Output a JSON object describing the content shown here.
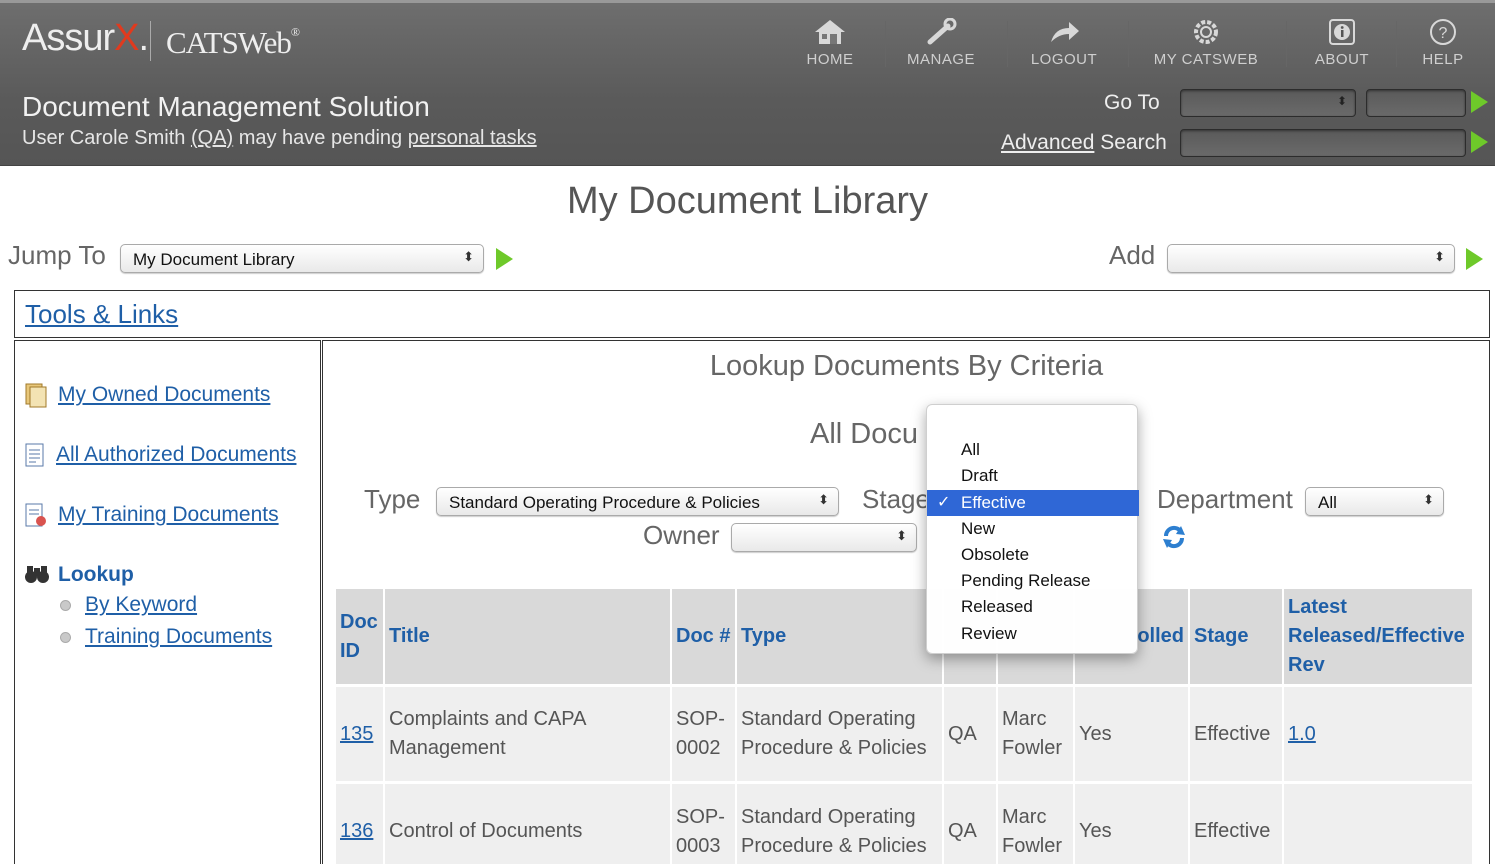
{
  "header": {
    "logo_left": "Assur",
    "logo_x": "X",
    "logo_dot": ".",
    "logo_right": "CATSWeb",
    "logo_tm": "®",
    "app_title": "Document Management Solution",
    "user_prefix": "User Carole Smith ",
    "user_group": "(QA)",
    "user_middle": " may have pending ",
    "user_tasks": "personal tasks",
    "nav": [
      {
        "label": "HOME",
        "icon": "home-icon"
      },
      {
        "label": "MANAGE",
        "icon": "wrench-icon"
      },
      {
        "label": "LOGOUT",
        "icon": "logout-arrow-icon"
      },
      {
        "label": "MY CATSWEB",
        "icon": "gear-icon"
      },
      {
        "label": "ABOUT",
        "icon": "info-icon"
      },
      {
        "label": "HELP",
        "icon": "help-icon"
      }
    ],
    "goto_label": "Go To",
    "advanced": "Advanced",
    "search": " Search"
  },
  "page_title": "My Document Library",
  "jump": {
    "label": "Jump To",
    "value": "My Document Library"
  },
  "add": {
    "label": "Add",
    "value": ""
  },
  "tools_links": "Tools & Links",
  "sidebar": {
    "items": [
      {
        "label": "My Owned Documents",
        "icon": "folder-icon"
      },
      {
        "label": "All Authorized Documents",
        "icon": "document-icon"
      },
      {
        "label": "My Training Documents",
        "icon": "training-document-icon"
      }
    ],
    "lookup": {
      "label": "Lookup",
      "icon": "binoculars-icon"
    },
    "sub_items": [
      "By Keyword",
      "Training Documents"
    ]
  },
  "main": {
    "title": "Lookup Documents By Criteria",
    "subtitle": "All Docu",
    "type_label": "Type",
    "type_value": "Standard Operating Procedure & Policies",
    "stage_label": "Stage",
    "dept_label": "Department",
    "dept_value": "All",
    "owner_label": "Owner",
    "owner_value": ""
  },
  "stage_dropdown": {
    "options": [
      "All",
      "Draft",
      "Effective",
      "New",
      "Obsolete",
      "Pending Release",
      "Released",
      "Review"
    ],
    "selected": "Effective",
    "check": "✓"
  },
  "table": {
    "headers": [
      "Doc ID",
      "Title",
      "Doc #",
      "Type",
      "",
      "",
      "olled",
      "Stage",
      "Latest Released/Effective Rev"
    ],
    "rows": [
      {
        "id": "135",
        "title": "Complaints and CAPA Management",
        "docno": "SOP-0002",
        "type": "Standard Operating Procedure & Policies",
        "dept": "QA",
        "owner": "Marc Fowler",
        "controlled": "Yes",
        "stage": "Effective",
        "rev": "1.0"
      },
      {
        "id": "136",
        "title": "Control of Documents",
        "docno": "SOP-0003",
        "type": "Standard Operating Procedure & Policies",
        "dept": "QA",
        "owner": "Marc Fowler",
        "controlled": "Yes",
        "stage": "Effective",
        "rev": ""
      }
    ]
  },
  "colors": {
    "header_bg": "#5f5f5f",
    "link": "#1f5fa7",
    "go_green": "#6ec92a",
    "selection": "#2f67d6"
  }
}
